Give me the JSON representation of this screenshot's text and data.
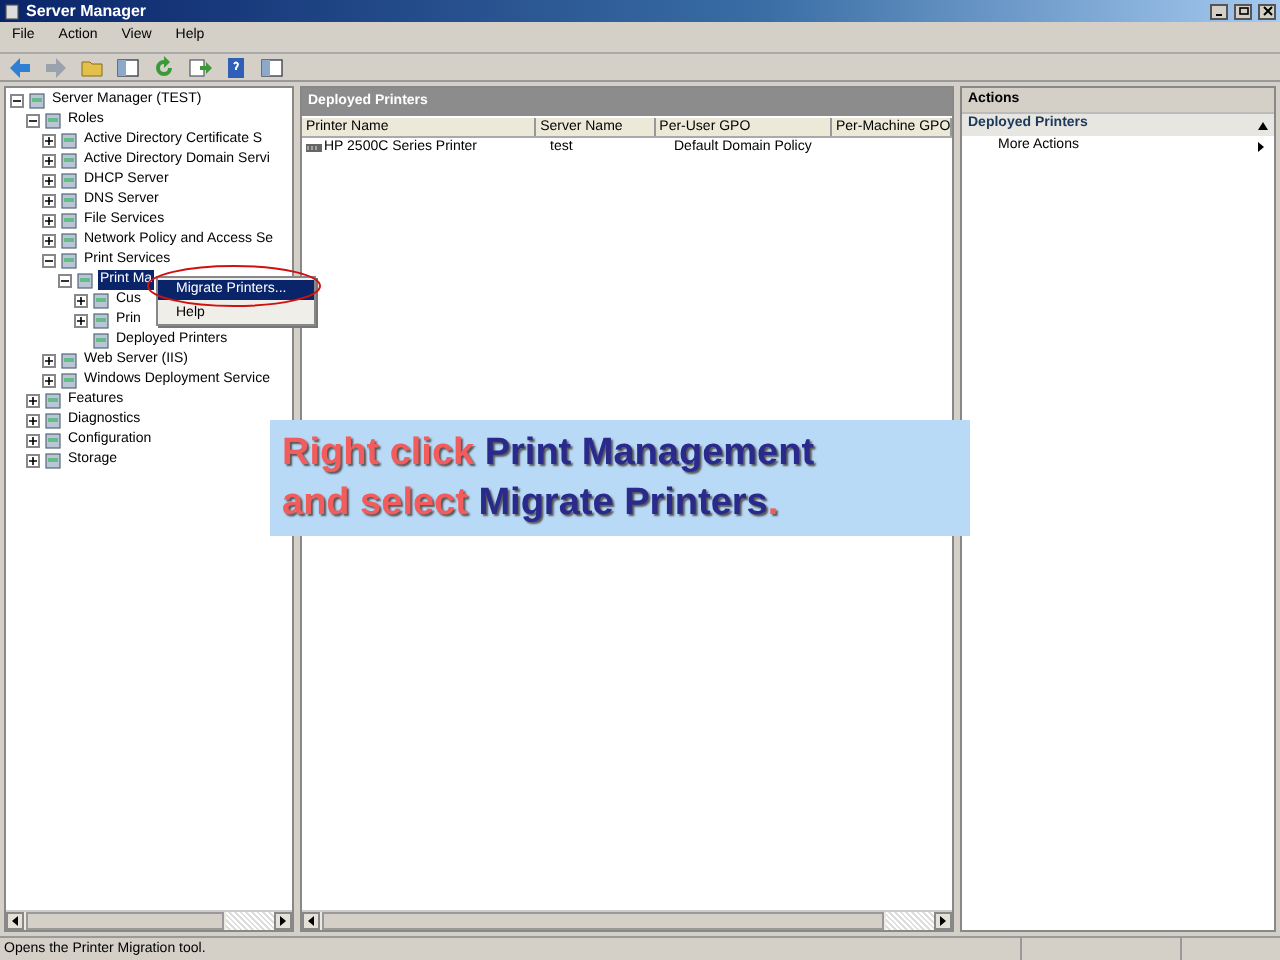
{
  "window": {
    "title": "Server Manager"
  },
  "menu": [
    "File",
    "Action",
    "View",
    "Help"
  ],
  "toolbar": [
    {
      "kind": "back"
    },
    {
      "kind": "forward"
    },
    {
      "kind": "folder"
    },
    {
      "kind": "pane"
    },
    {
      "kind": "refresh"
    },
    {
      "kind": "export"
    },
    {
      "kind": "help"
    },
    {
      "kind": "pane"
    }
  ],
  "tree": [
    {
      "label": "Server Manager (TEST)",
      "expanded": true,
      "selected": false,
      "children": [
        {
          "label": "Roles",
          "expanded": true,
          "selected": false,
          "children": [
            {
              "label": "Active Directory Certificate S",
              "expanded": false,
              "selected": false
            },
            {
              "label": "Active Directory Domain Servi",
              "expanded": false,
              "selected": false
            },
            {
              "label": "DHCP Server",
              "expanded": false,
              "selected": false
            },
            {
              "label": "DNS Server",
              "expanded": false,
              "selected": false
            },
            {
              "label": "File Services",
              "expanded": false,
              "selected": false
            },
            {
              "label": "Network Policy and Access Se",
              "expanded": false,
              "selected": false
            },
            {
              "label": "Print Services",
              "expanded": true,
              "selected": false,
              "children": [
                {
                  "label": "Print Ma",
                  "expanded": true,
                  "selected": true,
                  "children": [
                    {
                      "label": "Cus",
                      "expanded": false,
                      "selected": false
                    },
                    {
                      "label": "Prin",
                      "expanded": false,
                      "selected": false
                    },
                    {
                      "label": "Deployed Printers",
                      "selected": false
                    }
                  ]
                }
              ]
            },
            {
              "label": "Web Server (IIS)",
              "expanded": false,
              "selected": false
            },
            {
              "label": "Windows Deployment Service",
              "expanded": false,
              "selected": false
            }
          ]
        },
        {
          "label": "Features",
          "expanded": false,
          "selected": false
        },
        {
          "label": "Diagnostics",
          "expanded": false,
          "selected": false
        },
        {
          "label": "Configuration",
          "expanded": false,
          "selected": false
        },
        {
          "label": "Storage",
          "expanded": false,
          "selected": false
        }
      ]
    }
  ],
  "context_menu": [
    {
      "label": "Migrate Printers...",
      "selected": true
    },
    {
      "label": "Help",
      "selected": false
    }
  ],
  "center": {
    "title": "Deployed Printers",
    "columns": [
      "Printer Name",
      "Server Name",
      "Per-User GPO",
      "Per-Machine GPO"
    ],
    "rows": [
      {
        "cells": [
          "HP 2500C Series Printer",
          "test",
          "Default Domain Policy"
        ]
      }
    ]
  },
  "actions": {
    "title": "Actions",
    "section": {
      "label": "Deployed Printers",
      "expanded": true
    },
    "items": [
      "More Actions"
    ]
  },
  "callout": {
    "lines": [
      [
        {
          "text": "Right click ",
          "kind": "emphasis"
        },
        {
          "text": "Print Management",
          "kind": "plain"
        }
      ],
      [
        {
          "text": "and select ",
          "kind": "emphasis"
        },
        {
          "text": "Migrate Printers",
          "kind": "plain"
        },
        {
          "text": ".",
          "kind": "emphasis"
        }
      ]
    ]
  },
  "status_bar": "Opens the Printer Migration tool."
}
